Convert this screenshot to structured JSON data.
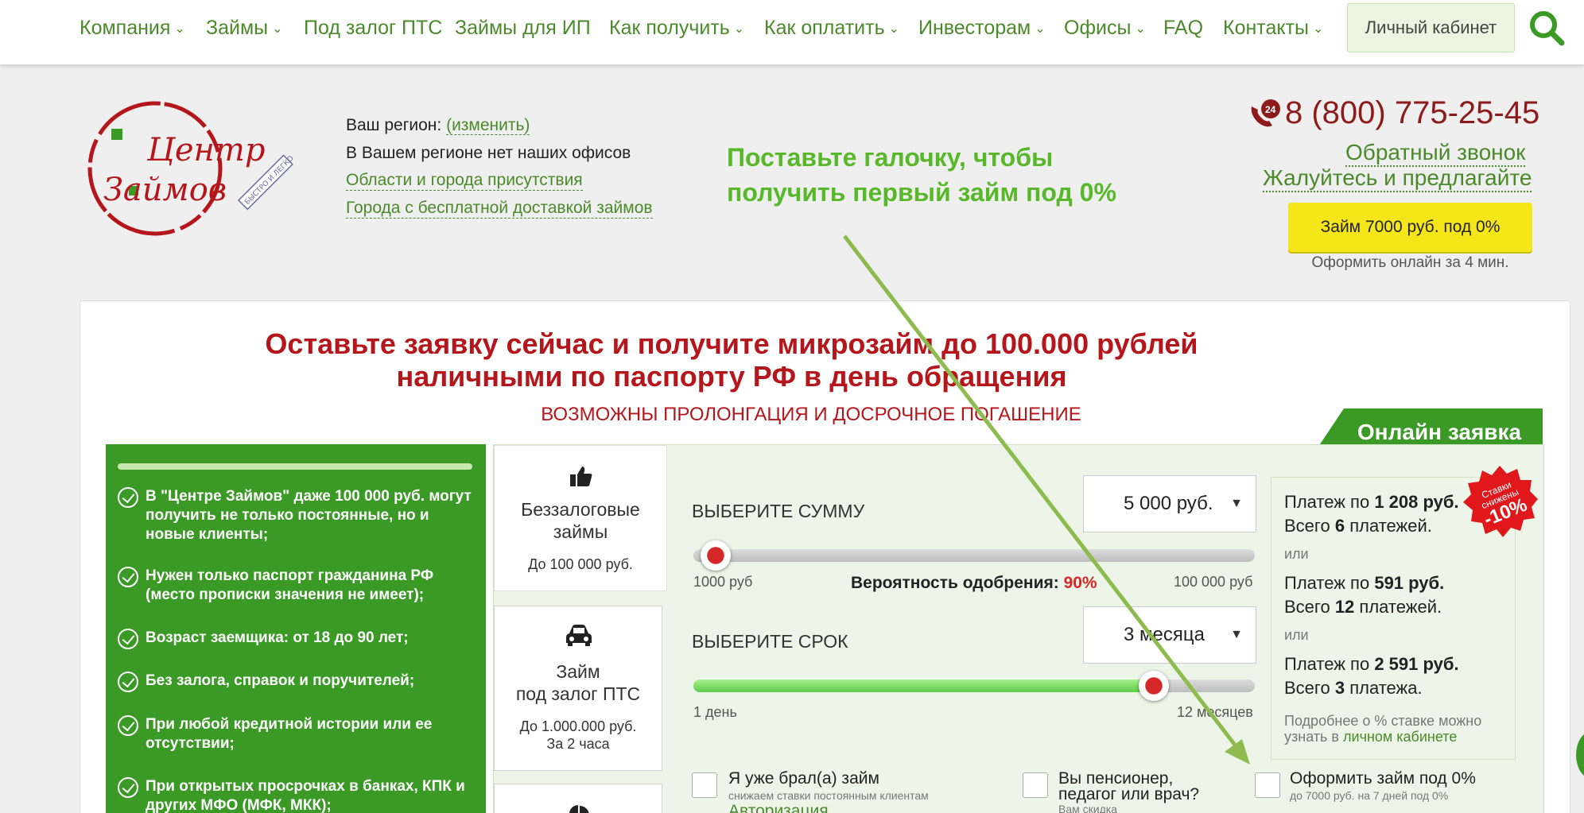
{
  "nav": {
    "items": [
      {
        "label": "Компания",
        "dropdown": true
      },
      {
        "label": "Займы",
        "dropdown": true
      },
      {
        "label": "Под залог ПТС",
        "dropdown": false
      },
      {
        "label": "Займы для ИП",
        "dropdown": false
      },
      {
        "label": "Как получить",
        "dropdown": true
      },
      {
        "label": "Как оплатить",
        "dropdown": true
      },
      {
        "label": "Инвесторам",
        "dropdown": true
      },
      {
        "label": "Офисы",
        "dropdown": true
      },
      {
        "label": "FAQ",
        "dropdown": false
      },
      {
        "label": "Контакты",
        "dropdown": true
      }
    ],
    "chevron": "⌄",
    "cabinet_label": "Личный кабинет",
    "search_icon": "search-icon"
  },
  "logo": {
    "line1": "Центр",
    "line2": "Займов",
    "stamp": "БЫСТРО И ЛЕГКО"
  },
  "region": {
    "label": "Ваш регион:",
    "change": "(изменить)",
    "no_offices": "В Вашем регионе нет наших офисов",
    "areas_link": "Области и города присутствия",
    "delivery_link": "Города с бесплатной доставкой займов"
  },
  "annotation": {
    "line1": "Поставьте галочку, чтобы",
    "line2": "получить первый займ под 0%",
    "color": "#58b82a"
  },
  "contacts": {
    "phone": "8 (800) 775-25-45",
    "phone_icon_text": "24",
    "callback": "Обратный звонок",
    "complaints": "Жалуйтесь и предлагайте",
    "loan_button": "Займ 7000 руб. под 0%",
    "loan_sub": "Оформить онлайн за 4 мин."
  },
  "main": {
    "headline1": "Оставьте заявку сейчас и получите микрозайм до 100.000 рублей",
    "headline2": "наличными по паспорту РФ в день обращения",
    "subheadline": "ВОЗМОЖНЫ ПРОЛОНГАЦИЯ И ДОСРОЧНОЕ ПОГАШЕНИЕ",
    "online_tab": "Онлайн заявка"
  },
  "benefits": [
    "В \"Центре Займов\" даже 100 000 руб. могут получить не только постоянные, но и новые клиенты;",
    "Нужен только паспорт гражданина РФ (место прописки значения не имеет);",
    "Возраст заемщика: от 18 до 90 лет;",
    "Без залога, справок и поручителей;",
    "При любой кредитной истории или ее отсутствии;",
    "При открытых просрочках в банках, КПК и других МФО (МФК, МКК);"
  ],
  "products": [
    {
      "title1": "Беззалоговые",
      "title2": "займы",
      "sub1": "До 100 000 руб.",
      "sub2": "",
      "icon": "thumbs-up-icon"
    },
    {
      "title1": "Займ",
      "title2": "под залог ПТС",
      "sub1": "До 1.000.000 руб.",
      "sub2": "За 2 часа",
      "icon": "car-icon"
    }
  ],
  "sum": {
    "label": "ВЫБЕРИТЕ СУММУ",
    "value": "5 000 руб.",
    "min": "1000 руб",
    "max": "100 000 руб",
    "fraction": 0.04
  },
  "approval": {
    "label": "Вероятность одобрения:",
    "value": "90%"
  },
  "term": {
    "label": "ВЫБЕРИТЕ СРОК",
    "value": "3 месяца",
    "min": "1 день",
    "max": "12 месяцев",
    "fraction": 0.82
  },
  "payments": {
    "row1_prefix": "Платеж по",
    "row1_amount": "1 208 руб.",
    "row1_total_prefix": "Всего",
    "row1_total_count": "6",
    "row1_total_suffix": "платежей.",
    "or": "или",
    "row2_prefix": "Платеж по",
    "row2_amount": "591 руб.",
    "row2_total_prefix": "Всего",
    "row2_total_count": "12",
    "row2_total_suffix": "платежей.",
    "row3_prefix": "Платеж по",
    "row3_amount": "2 591 руб.",
    "row3_total_prefix": "Всего",
    "row3_total_count": "3",
    "row3_total_suffix": "платежа.",
    "note": "Подробнее о % ставке можно узнать в",
    "note_link": "личном кабинете",
    "badge_line1": "Ставки",
    "badge_line2": "снижены",
    "badge_pct": "-10%"
  },
  "checkboxes": [
    {
      "title": "Я уже брал(а) займ",
      "title2": "",
      "sub": "снижаем ставки постоянным клиентам",
      "extra": "Авторизация",
      "checked": false
    },
    {
      "title": "Вы пенсионер,",
      "title2": "педагог или врач?",
      "sub": "Вам скидка",
      "extra": "",
      "checked": false
    },
    {
      "title": "Оформить займ под 0%",
      "title2": "",
      "sub": "до 7000 руб. на 7 дней под 0%",
      "extra": "",
      "checked": false
    }
  ],
  "colors": {
    "brand_green": "#3a9a25",
    "link_green": "#4b8a2a",
    "headline_red": "#b4161b",
    "button_yellow": "#f5e61a"
  }
}
